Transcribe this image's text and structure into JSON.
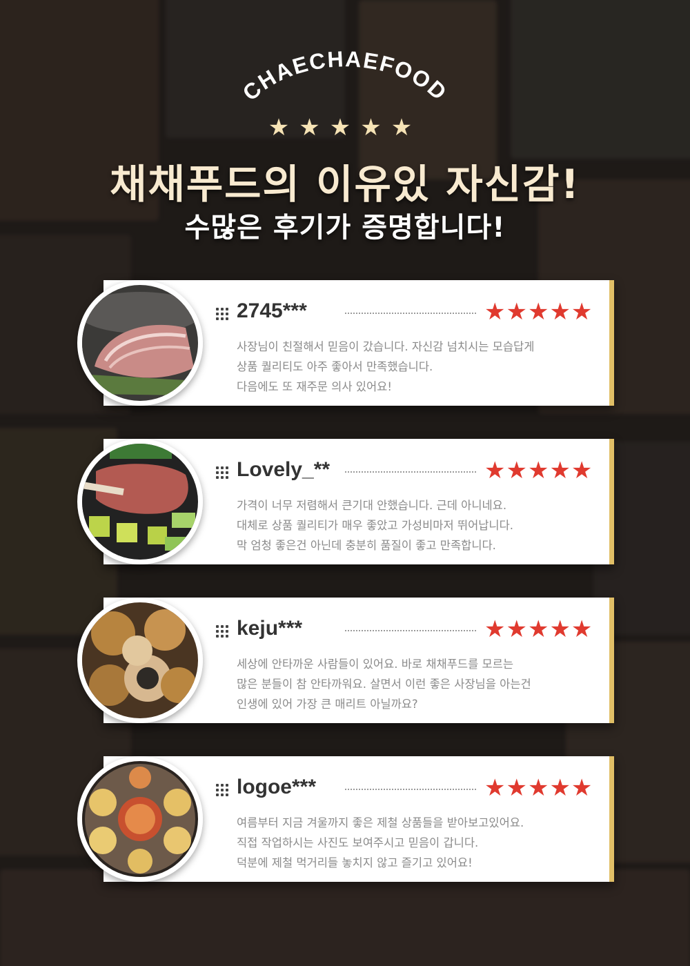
{
  "hero": {
    "brand": "CHAECHAEFOOD",
    "stars": "★★★★★",
    "headline": "채채푸드의 이유있 자신감!",
    "subline": "수많은 후기가 증명합니다!"
  },
  "reviews": [
    {
      "user": "2745***",
      "rating": "★★★★★",
      "lines": [
        "사장님이 친절해서 믿음이 갔습니다. 자신감 넘치시는 모습답게",
        "상품 퀄리티도 아주 좋아서 만족했습니다.",
        "다음에도 또 재주문 의사 있어요!"
      ]
    },
    {
      "user": "Lovely_**",
      "rating": "★★★★★",
      "lines": [
        "가격이 너무 저렴해서 큰기대 안했습니다. 근데 아니네요.",
        "대체로 상품 퀄리티가 매우 좋았고 가성비마저 뛰어납니다.",
        "막 엄청 좋은건 아닌데 충분히 품질이 좋고 만족합니다."
      ]
    },
    {
      "user": "keju***",
      "rating": "★★★★★",
      "lines": [
        "세상에 안타까운 사람들이 있어요. 바로 채채푸드를 모르는",
        "많은 분들이 참 안타까워요. 살면서 이런 좋은 사장님을 아는건",
        "인생에 있어 가장 큰 매리트 아닐까요?"
      ]
    },
    {
      "user": "logoe***",
      "rating": "★★★★★",
      "lines": [
        "여름부터 지금 겨울까지 좋은 제철 상품들을 받아보고있어요.",
        "직접 작업하시는 사진도 보여주시고 믿음이 갑니다.",
        "덕분에 제철 먹거리들 놓치지 않고 즐기고 있어요!"
      ]
    }
  ],
  "colors": {
    "accent_bar": "#e1bf67",
    "star_red": "#e03a2f",
    "star_cream": "#f6e3b5"
  }
}
